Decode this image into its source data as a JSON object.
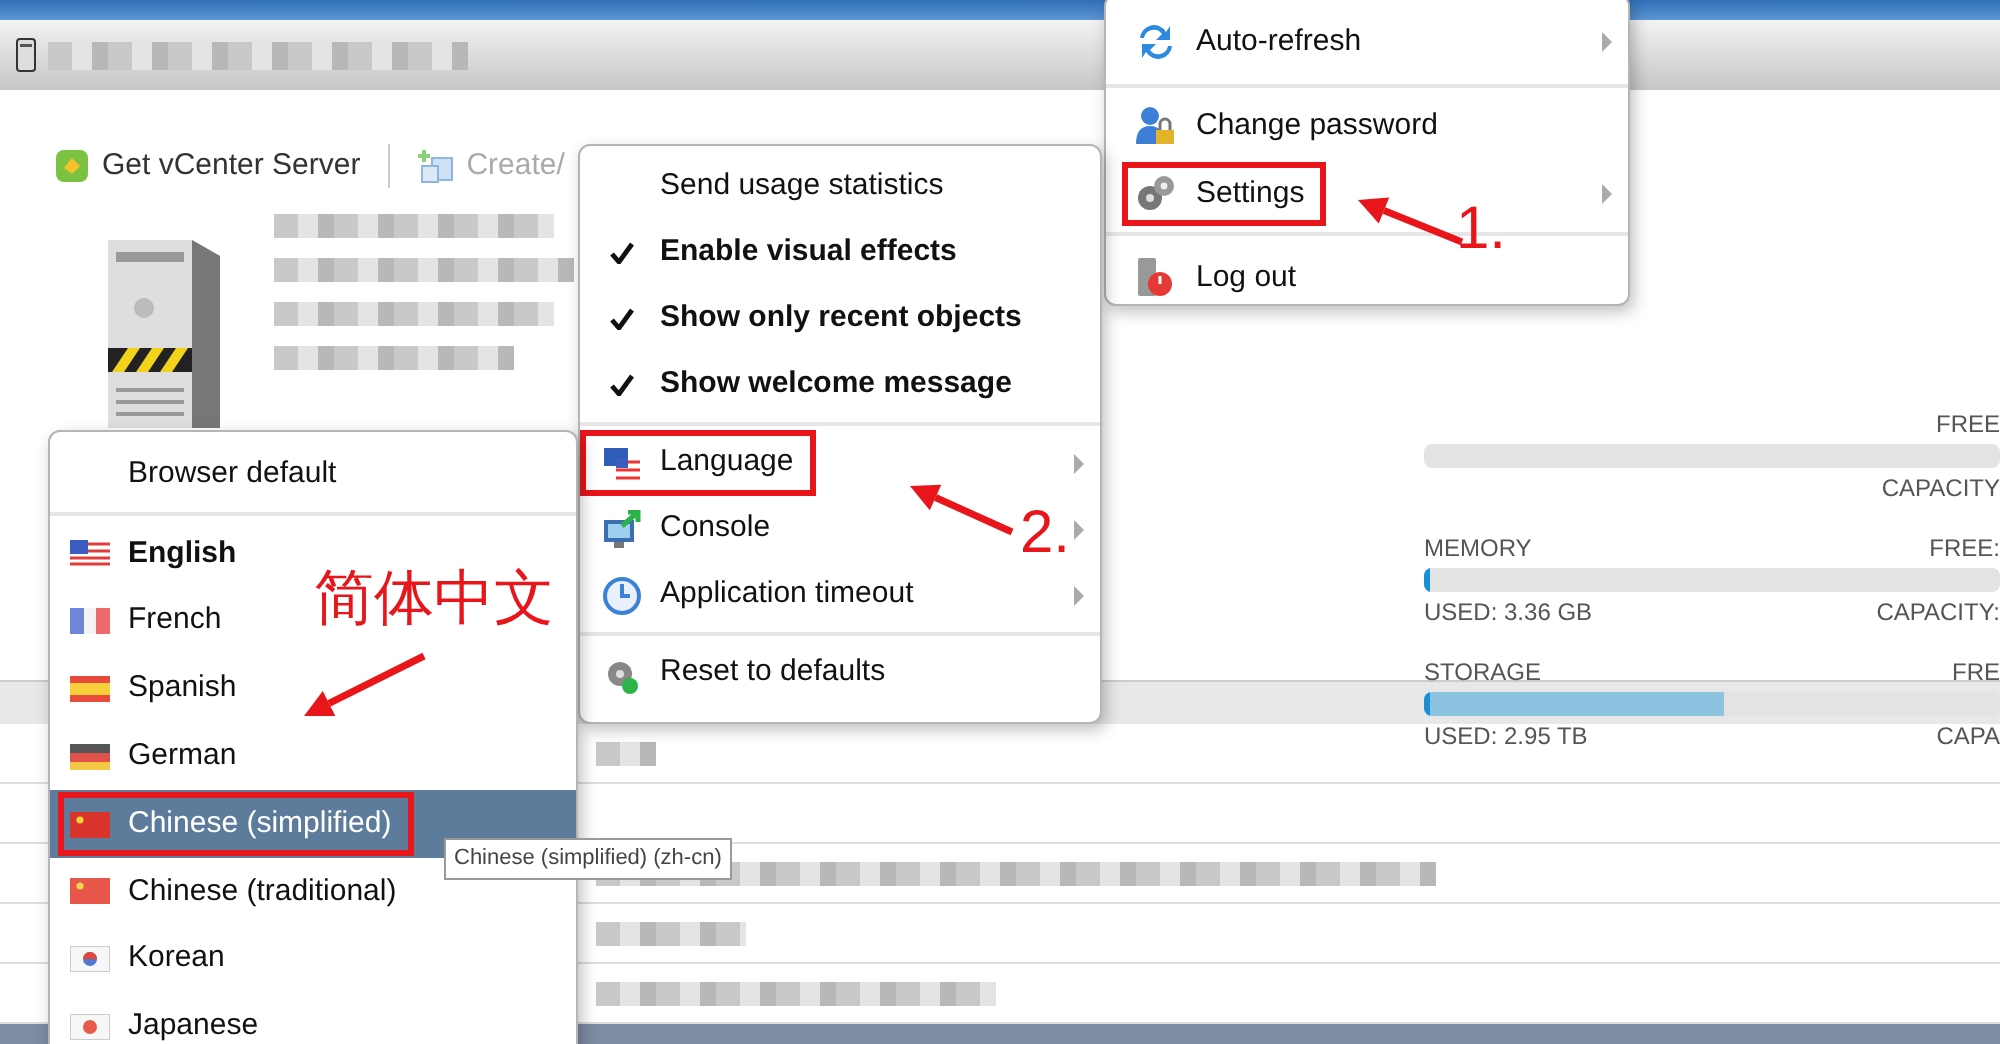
{
  "toolbar": [
    {
      "label": "Get vCenter Server",
      "disabled": false
    },
    {
      "label": "Create/",
      "disabled": true
    }
  ],
  "resources": [
    {
      "free_label": "FREE",
      "capacity_label": "CAPACITY"
    },
    {
      "name": "MEMORY",
      "free_label": "FREE:",
      "used": "USED: 3.36 GB",
      "capacity_label": "CAPACITY:",
      "level": 0.01
    },
    {
      "name": "STORAGE",
      "free_label": "FRE",
      "used": "USED: 2.95 TB",
      "capacity_label": "CAPA",
      "level": 0.52
    }
  ],
  "user_menu": {
    "sections": [
      [
        {
          "label": "Auto-refresh",
          "submenu": true,
          "highlighted": false
        }
      ],
      [
        {
          "label": "Change password",
          "submenu": false,
          "highlighted": false
        },
        {
          "label": "Settings",
          "submenu": true,
          "highlighted": true
        }
      ],
      [
        {
          "label": "Log out",
          "submenu": false,
          "highlighted": false
        }
      ]
    ]
  },
  "settings_menu": {
    "sections": [
      [
        {
          "label": "Send usage statistics",
          "kind": "toggle",
          "checked": false
        },
        {
          "label": "Enable visual effects",
          "kind": "toggle",
          "checked": true
        },
        {
          "label": "Show only recent objects",
          "kind": "toggle",
          "checked": true
        },
        {
          "label": "Show welcome message",
          "kind": "toggle",
          "checked": true
        }
      ],
      [
        {
          "label": "Language",
          "kind": "submenu",
          "highlighted": true
        },
        {
          "label": "Console",
          "kind": "submenu",
          "highlighted": false
        },
        {
          "label": "Application timeout",
          "kind": "submenu",
          "highlighted": false
        }
      ],
      [
        {
          "label": "Reset to defaults",
          "kind": "action",
          "highlighted": false
        }
      ]
    ]
  },
  "language_menu": {
    "sections": [
      [
        {
          "label": "Browser default",
          "selected": false,
          "current": false,
          "highlighted": false
        }
      ],
      [
        {
          "label": "English",
          "selected": false,
          "current": true,
          "highlighted": false
        },
        {
          "label": "French",
          "selected": false,
          "current": false,
          "highlighted": false
        },
        {
          "label": "Spanish",
          "selected": false,
          "current": false,
          "highlighted": false
        },
        {
          "label": "German",
          "selected": false,
          "current": false,
          "highlighted": false
        },
        {
          "label": "Chinese (simplified)",
          "selected": true,
          "current": false,
          "highlighted": true
        },
        {
          "label": "Chinese (traditional)",
          "selected": false,
          "current": false,
          "highlighted": false
        },
        {
          "label": "Korean",
          "selected": false,
          "current": false,
          "highlighted": false
        },
        {
          "label": "Japanese",
          "selected": false,
          "current": false,
          "highlighted": false
        }
      ]
    ]
  },
  "tooltip": "Chinese (simplified) (zh-cn)",
  "annotations": [
    {
      "text": "1."
    },
    {
      "text": "2."
    },
    {
      "text": "简体中文"
    }
  ]
}
